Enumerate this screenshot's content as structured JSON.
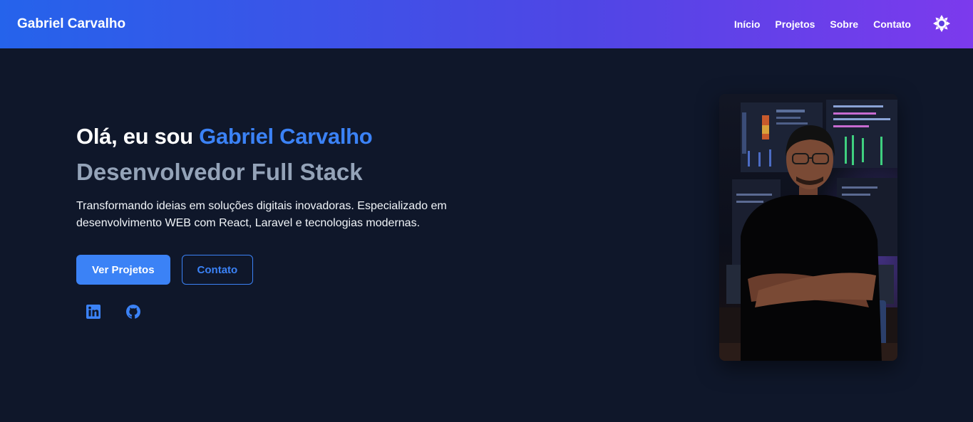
{
  "header": {
    "brand": "Gabriel Carvalho",
    "nav": [
      {
        "label": "Início"
      },
      {
        "label": "Projetos"
      },
      {
        "label": "Sobre"
      },
      {
        "label": "Contato"
      }
    ],
    "theme_toggle_icon": "sun-icon"
  },
  "hero": {
    "greeting_prefix": "Olá, eu sou",
    "greeting_name": "Gabriel Carvalho",
    "role": "Desenvolvedor Full Stack",
    "description": "Transformando ideias em soluções digitais inovadoras. Especializado em desenvolvimento WEB com React, Laravel e tecnologias modernas.",
    "primary_button": "Ver Projetos",
    "secondary_button": "Contato",
    "socials": [
      {
        "icon": "linkedin-icon"
      },
      {
        "icon": "github-icon"
      }
    ]
  },
  "colors": {
    "accent": "#3b82f6",
    "background": "#0f172a",
    "header_gradient_start": "#2563eb",
    "header_gradient_end": "#7c3aed",
    "muted_text": "#94a3b8"
  }
}
